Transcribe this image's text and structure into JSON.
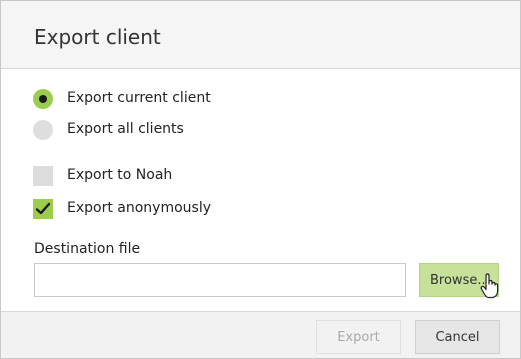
{
  "dialog": {
    "title": "Export client"
  },
  "options": {
    "export_current": {
      "label": "Export current client",
      "selected": true
    },
    "export_all": {
      "label": "Export all clients",
      "selected": false
    },
    "export_noah": {
      "label": "Export to Noah",
      "checked": false
    },
    "export_anon": {
      "label": "Export anonymously",
      "checked": true
    }
  },
  "destination": {
    "label": "Destination file",
    "value": "",
    "browse_label": "Browse..."
  },
  "footer": {
    "export_label": "Export",
    "cancel_label": "Cancel"
  },
  "colors": {
    "accent_green": "#9ccc4e",
    "browse_green": "#c7e09a"
  }
}
